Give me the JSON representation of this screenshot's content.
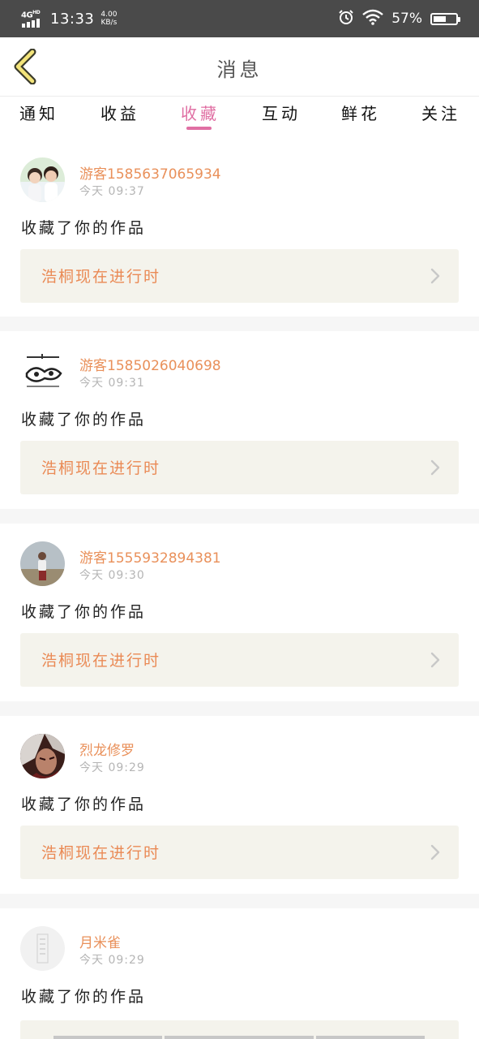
{
  "status_bar": {
    "network": "4G",
    "network_sup": "HD",
    "time": "13:33",
    "speed_value": "4.00",
    "speed_unit": "KB/s",
    "battery_percent": "57%",
    "battery_level": 0.57
  },
  "header": {
    "title": "消息"
  },
  "tabs": [
    {
      "label": "通知",
      "active": false
    },
    {
      "label": "收益",
      "active": false
    },
    {
      "label": "收藏",
      "active": true
    },
    {
      "label": "互动",
      "active": false
    },
    {
      "label": "鲜花",
      "active": false
    },
    {
      "label": "关注",
      "active": false
    }
  ],
  "colors": {
    "accent": "#e06fa3",
    "username": "#e9905a",
    "work_title": "#ea8a55",
    "card_bg": "#f4f3ec"
  },
  "messages": [
    {
      "username": "游客1585637065934",
      "time": "今天 09:37",
      "action": "收藏了你的作品",
      "work": "浩桐现在进行时"
    },
    {
      "username": "游客1585026040698",
      "time": "今天 09:31",
      "action": "收藏了你的作品",
      "work": "浩桐现在进行时"
    },
    {
      "username": "游客1555932894381",
      "time": "今天 09:30",
      "action": "收藏了你的作品",
      "work": "浩桐现在进行时"
    },
    {
      "username": "烈龙修罗",
      "time": "今天 09:29",
      "action": "收藏了你的作品",
      "work": "浩桐现在进行时"
    },
    {
      "username": "月米雀",
      "time": "今天 09:29",
      "action": "收藏了你的作品",
      "work": ""
    }
  ]
}
